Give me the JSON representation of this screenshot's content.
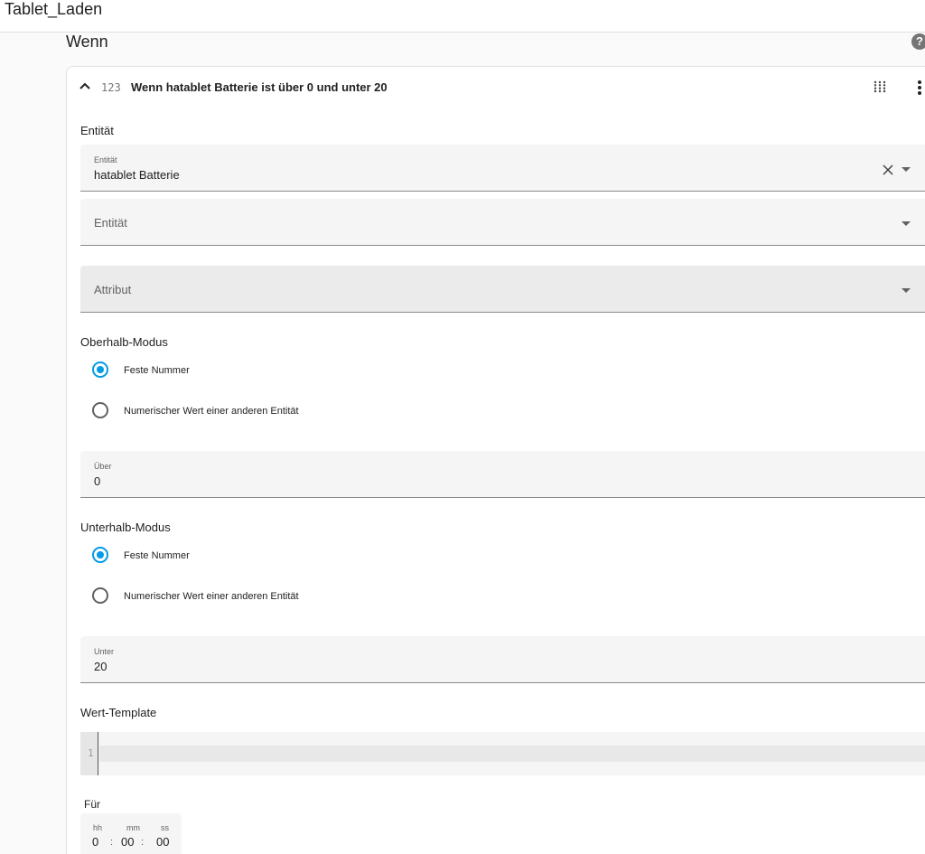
{
  "app": {
    "title": "Tablet_Laden"
  },
  "section": {
    "title": "Wenn",
    "help_icon": "help-circle-icon",
    "help_glyph": "?"
  },
  "condition": {
    "type_icon_text": "123",
    "title": "Wenn hatablet Batterie ist über 0 und unter 20"
  },
  "entity_section": {
    "label": "Entität",
    "entity_field": {
      "label": "Entität",
      "value": "hatablet Batterie"
    },
    "entity_add_placeholder": "Entität",
    "attribute_placeholder": "Attribut"
  },
  "above_mode": {
    "label": "Oberhalb-Modus",
    "options": [
      {
        "label": "Feste Nummer",
        "checked": true
      },
      {
        "label": "Numerischer Wert einer anderen Entität",
        "checked": false
      }
    ],
    "field": {
      "label": "Über",
      "value": "0"
    }
  },
  "below_mode": {
    "label": "Unterhalb-Modus",
    "options": [
      {
        "label": "Feste Nummer",
        "checked": true
      },
      {
        "label": "Numerischer Wert einer anderen Entität",
        "checked": false
      }
    ],
    "field": {
      "label": "Unter",
      "value": "20"
    }
  },
  "value_template": {
    "label": "Wert-Template",
    "line_number": "1",
    "content": ""
  },
  "duration": {
    "label": "Für",
    "hh_label": "hh",
    "mm_label": "mm",
    "ss_label": "ss",
    "hh": "0",
    "mm": "00",
    "ss": "00",
    "separator": ":"
  },
  "colors": {
    "accent": "#039be5",
    "field_bg": "#f5f5f5",
    "page_bg": "#fafafa"
  }
}
